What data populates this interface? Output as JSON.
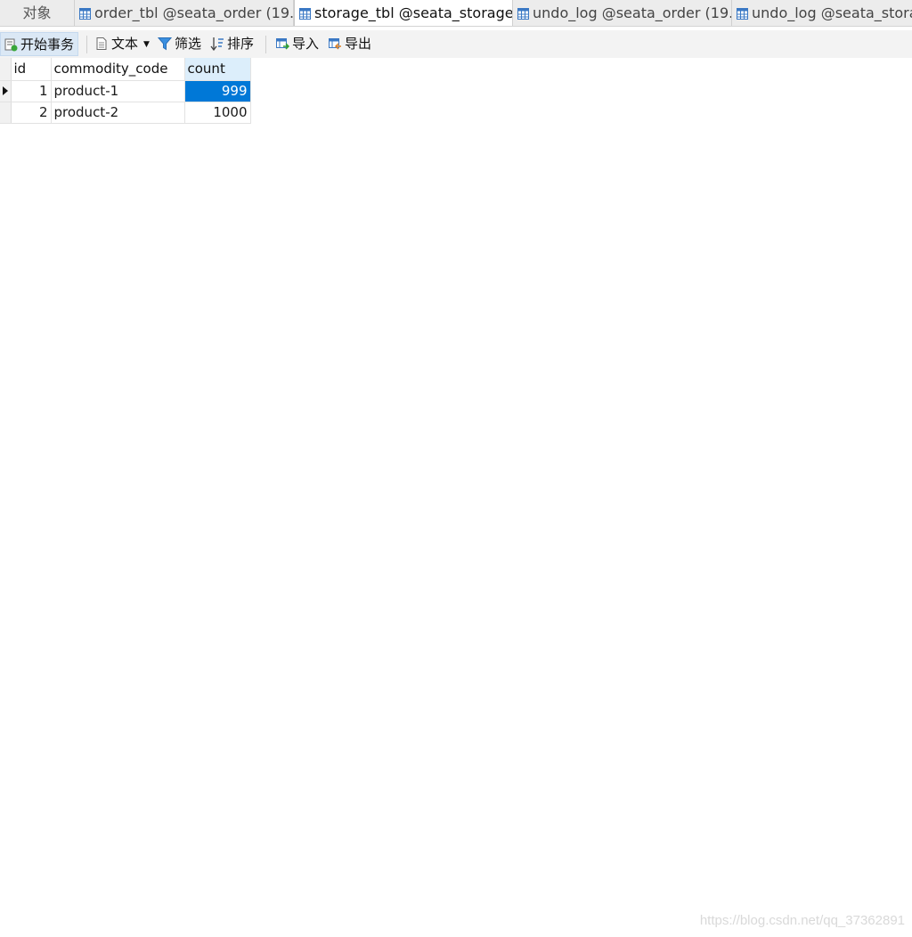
{
  "tabs": {
    "objects_label": "对象",
    "items": [
      {
        "label": "order_tbl @seata_order (19...",
        "icon": "table-icon"
      },
      {
        "label": "storage_tbl @seata_storage...",
        "icon": "table-icon",
        "active": true
      },
      {
        "label": "undo_log @seata_order (19...",
        "icon": "table-icon"
      },
      {
        "label": "undo_log @seata_storag",
        "icon": "table-icon"
      }
    ]
  },
  "toolbar": {
    "begin_transaction_label": "开始事务",
    "text_label": "文本",
    "filter_label": "筛选",
    "sort_label": "排序",
    "import_label": "导入",
    "export_label": "导出"
  },
  "grid": {
    "columns": [
      "id",
      "commodity_code",
      "count"
    ],
    "selected_column": "count",
    "rows": [
      {
        "id": "1",
        "commodity_code": "product-1",
        "count": "999",
        "current": true
      },
      {
        "id": "2",
        "commodity_code": "product-2",
        "count": "1000",
        "current": false
      }
    ],
    "selected_cell": {
      "row": 0,
      "column": "count"
    }
  },
  "colors": {
    "selection": "#0078d7",
    "header_selected": "#dceefb",
    "active_tab": "#ffffff"
  },
  "watermark": "https://blog.csdn.net/qq_37362891"
}
